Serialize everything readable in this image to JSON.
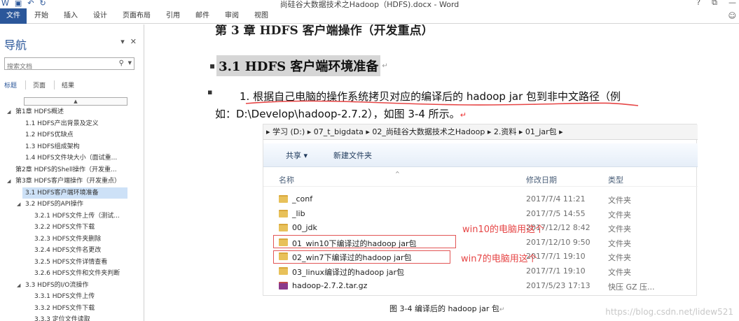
{
  "window": {
    "title": "尚硅谷大数据技术之Hadoop（HDFS).docx - Word",
    "qat_icons": [
      "word-icon",
      "save-icon",
      "undo-icon",
      "redo-icon"
    ],
    "controls": [
      "?",
      "⧉",
      "—"
    ]
  },
  "ribbon": {
    "tabs": [
      "文件",
      "开始",
      "插入",
      "设计",
      "页面布局",
      "引用",
      "邮件",
      "审阅",
      "视图"
    ]
  },
  "nav": {
    "title": "导航",
    "search_placeholder": "搜索文档",
    "tabs": [
      "标题",
      "页面",
      "结果"
    ],
    "items": [
      {
        "label": "第1章 HDFS概述",
        "level": 0,
        "expanded": true
      },
      {
        "label": "1.1 HDFS产出背景及定义",
        "level": 1
      },
      {
        "label": "1.2 HDFS优缺点",
        "level": 1
      },
      {
        "label": "1.3 HDFS组成架构",
        "level": 1
      },
      {
        "label": "1.4 HDFS文件块大小（面试重...",
        "level": 1
      },
      {
        "label": "第2章 HDFS的Shell操作（开发重...",
        "level": 0
      },
      {
        "label": "第3章 HDFS客户端操作（开发重点）",
        "level": 0,
        "expanded": true
      },
      {
        "label": "3.1 HDFS客户端环境准备",
        "level": 1,
        "selected": true
      },
      {
        "label": "3.2 HDFS的API操作",
        "level": 1,
        "expanded": true
      },
      {
        "label": "3.2.1 HDFS文件上传（测试...",
        "level": 2
      },
      {
        "label": "3.2.2 HDFS文件下载",
        "level": 2
      },
      {
        "label": "3.2.3 HDFS文件夹删除",
        "level": 2
      },
      {
        "label": "3.2.4 HDFS文件名更改",
        "level": 2
      },
      {
        "label": "3.2.5 HDFS文件详情查看",
        "level": 2
      },
      {
        "label": "3.2.6 HDFS文件和文件夹判断",
        "level": 2
      },
      {
        "label": "3.3 HDFS的I/O流操作",
        "level": 1,
        "expanded": true
      },
      {
        "label": "3.3.1 HDFS文件上传",
        "level": 2
      },
      {
        "label": "3.3.2 HDFS文件下载",
        "level": 2
      },
      {
        "label": "3.3.3 定位文件读取",
        "level": 2
      }
    ]
  },
  "doc": {
    "chapter_heading_partial": "第 3 章 HDFS 客户端操作（开发重点）",
    "section_heading": "3.1 HDFS 客户端环境准备",
    "para_line1": "1. 根据自己电脑的操作系统拷贝对应的编译后的 hadoop jar 包到非中文路径（例",
    "para_line2": "如：D:\\Develop\\hadoop-2.7.2），如图 3-4 所示。",
    "caption": "图 3-4    编译后的 hadoop jar 包"
  },
  "explorer": {
    "breadcrumb": "▸  学习 (D:)  ▸  07_t_bigdata  ▸  02_尚硅谷大数据技术之Hadoop  ▸  2.资料  ▸  01_jar包  ▸",
    "share_label": "共享 ▾",
    "new_folder_label": "新建文件夹",
    "columns": [
      "名称",
      "修改日期",
      "类型"
    ],
    "rows": [
      {
        "name": "_conf",
        "date": "2017/7/4 11:21",
        "type": "文件夹"
      },
      {
        "name": "_lib",
        "date": "2017/7/5 14:55",
        "type": "文件夹"
      },
      {
        "name": "00_jdk",
        "date": "2017/12/12 8:42",
        "type": "文件夹"
      },
      {
        "name": "01_win10下编译过的hadoop jar包",
        "date": "2017/12/10 9:50",
        "type": "文件夹"
      },
      {
        "name": "02_win7下编译过的hadoop jar包",
        "date": "2017/7/1 19:10",
        "type": "文件夹"
      },
      {
        "name": "03_linux编译过的hadoop jar包",
        "date": "2017/7/1 19:10",
        "type": "文件夹"
      },
      {
        "name": "hadoop-2.7.2.tar.gz",
        "date": "2017/5/23 17:13",
        "type": "快压 GZ 压..."
      }
    ],
    "annotation_win10": "win10的电脑用这个",
    "annotation_win7": "win7的电脑用这个"
  },
  "watermark": "https://blog.csdn.net/lidew521",
  "colors": {
    "accent": "#2b579a",
    "annotation": "#e64545",
    "folder": "#e8c15a"
  }
}
